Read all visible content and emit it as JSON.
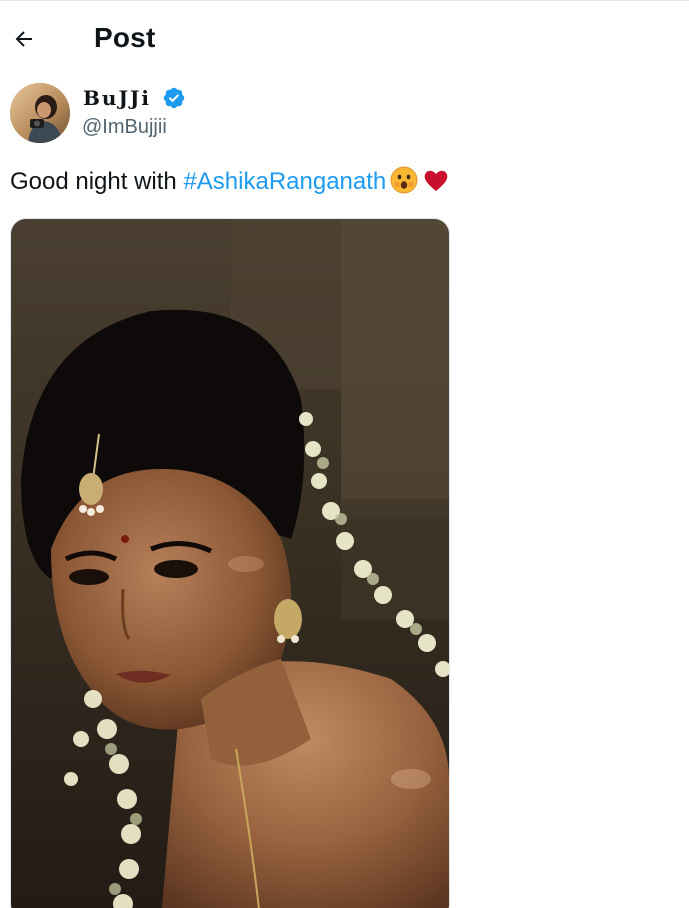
{
  "header": {
    "back_icon": "arrow-left-icon",
    "title": "Post"
  },
  "author": {
    "display_name": "BuJJi",
    "verified_icon": "verified-badge-icon",
    "verified_color": "#1d9bf0",
    "handle": "@ImBujjii"
  },
  "tweet": {
    "text_prefix": "Good night with ",
    "hashtag": "#AshikaRanganath",
    "emojis": [
      "face-with-open-mouth-emoji",
      "red-heart-emoji"
    ]
  },
  "media": {
    "type": "photo"
  },
  "colors": {
    "link": "#1d9bf0",
    "text": "#0f1419",
    "secondary": "#536471"
  }
}
